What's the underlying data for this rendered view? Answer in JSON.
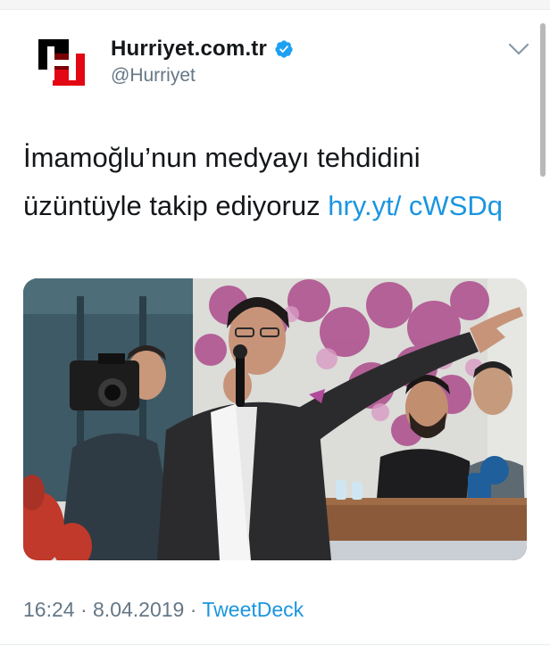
{
  "tweet": {
    "author": {
      "display_name": "Hurriyet.com.tr",
      "handle": "@Hurriyet",
      "verified": true,
      "avatar_icon": "hurriyet-h-logo",
      "logo_letter": "H"
    },
    "menu_icon": "chevron-down-icon",
    "text_main": "İmamoğlu’nun medyayı tehdidini üzüntüyle takip ediyoruz",
    "link_text": "hry.yt/ cWSDq",
    "media": {
      "kind": "photo",
      "subject": "speaker-with-microphone-at-rally"
    },
    "time": "16:24",
    "separator": "·",
    "date": "8.04.2019",
    "source": "TweetDeck"
  },
  "colors": {
    "text": "#14171a",
    "secondary": "#657786",
    "link": "#1b95e0",
    "verified": "#1da1f2",
    "logo_red": "#e30613",
    "logo_black": "#000000"
  }
}
